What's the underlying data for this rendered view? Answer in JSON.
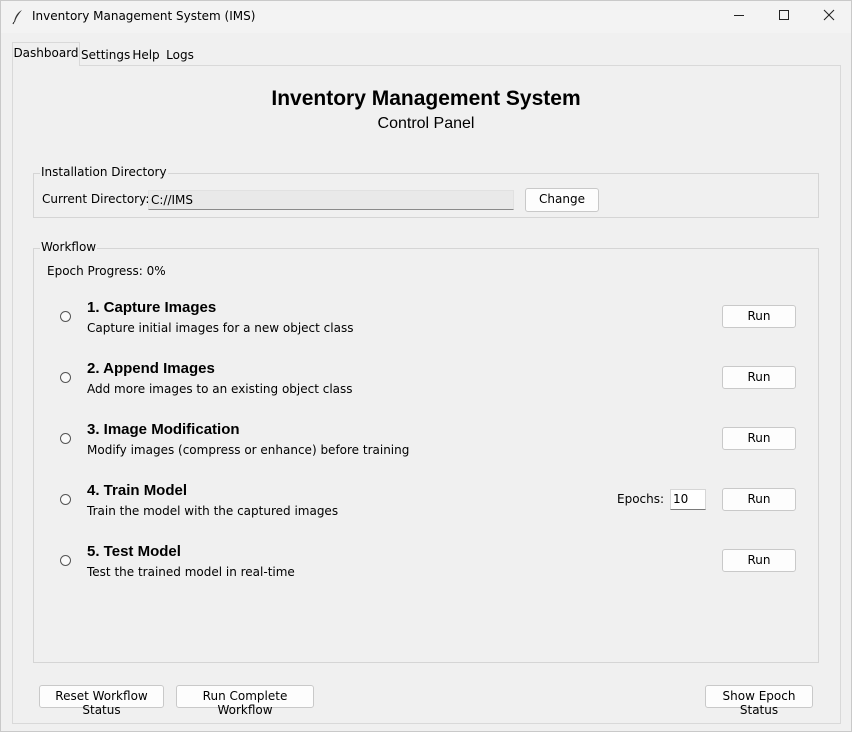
{
  "window": {
    "title": "Inventory Management System (IMS)",
    "controls": {
      "minimize_icon": "minimize-icon",
      "maximize_icon": "maximize-icon",
      "close_icon": "close-icon"
    }
  },
  "tabs": [
    {
      "label": "Dashboard",
      "active": true
    },
    {
      "label": "Settings",
      "active": false
    },
    {
      "label": "Help",
      "active": false
    },
    {
      "label": "Logs",
      "active": false
    }
  ],
  "header": {
    "title": "Inventory Management System",
    "subtitle": "Control Panel"
  },
  "installation": {
    "legend": "Installation Directory",
    "dir_label": "Current Directory:",
    "dir_value": "C://IMS",
    "change_label": "Change"
  },
  "workflow": {
    "legend": "Workflow",
    "epoch_progress": "Epoch Progress: 0%",
    "steps": [
      {
        "title": "1. Capture Images",
        "description": "Capture initial images for a new object class",
        "run_label": "Run"
      },
      {
        "title": "2. Append Images",
        "description": "Add more images to an existing object class",
        "run_label": "Run"
      },
      {
        "title": "3. Image Modification",
        "description": "Modify images (compress or enhance) before training",
        "run_label": "Run"
      },
      {
        "title": "4. Train Model",
        "description": "Train the model with the captured images",
        "run_label": "Run"
      },
      {
        "title": "5. Test Model",
        "description": "Test the trained model in real-time",
        "run_label": "Run"
      }
    ],
    "epochs_label": "Epochs:",
    "epochs_value": "10"
  },
  "footer": {
    "reset_label": "Reset Workflow Status",
    "complete_label": "Run Complete Workflow",
    "epoch_status_label": "Show Epoch Status"
  }
}
